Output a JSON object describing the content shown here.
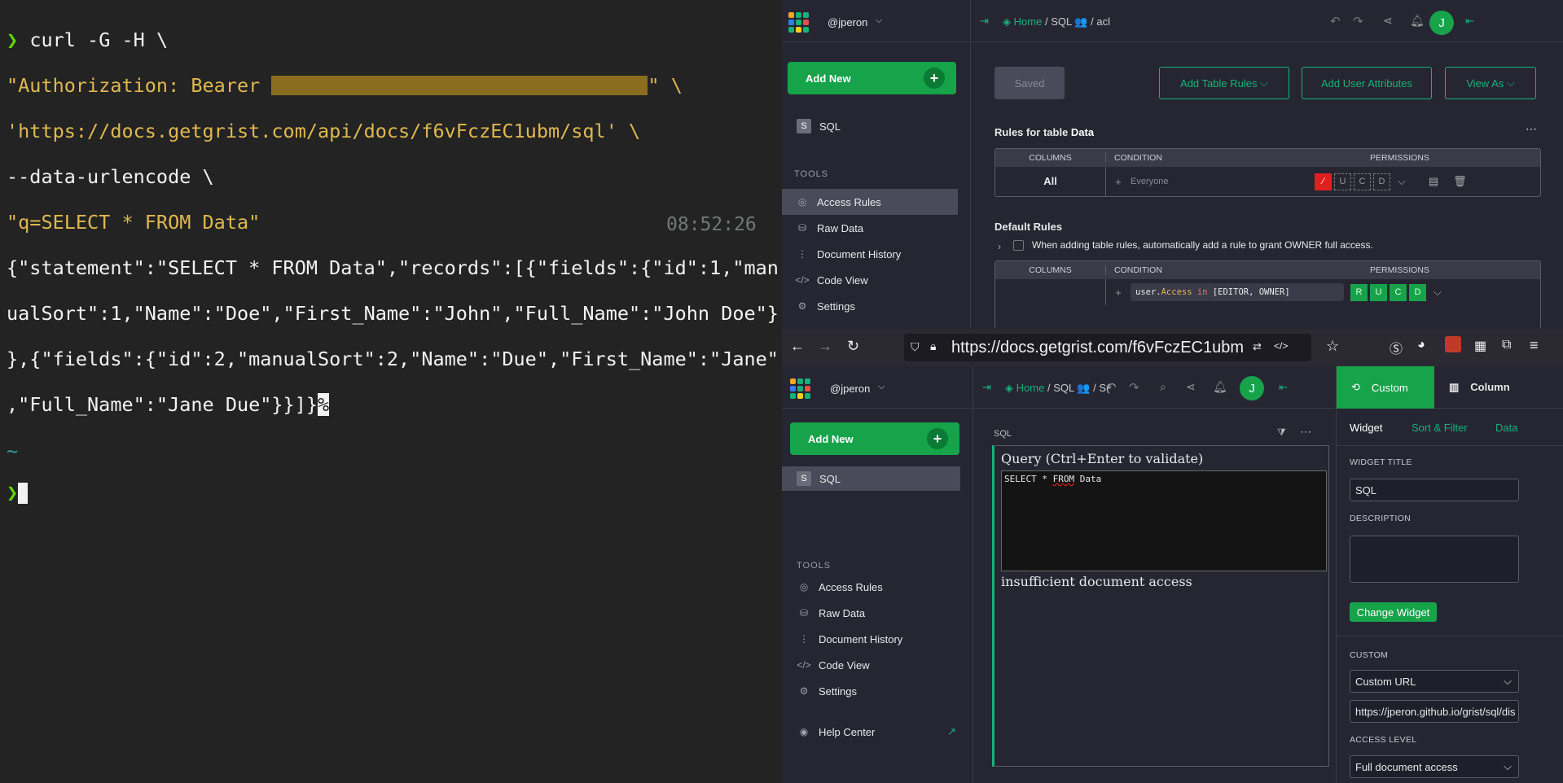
{
  "terminal": {
    "cmd1": "curl -G -H \\",
    "auth_prefix": "\"Authorization: Bearer ",
    "auth_suffix": "\" \\",
    "url_line": "'https://docs.getgrist.com/api/docs/f6vFczEC1ubm/sql' \\",
    "urlencode_line": "--data-urlencode \\",
    "query_line": "\"q=SELECT * FROM Data\"",
    "out1": "{\"statement\":\"SELECT * FROM Data\",\"records\":[{\"fields\":{\"id\":1,\"man",
    "out2": "ualSort\":1,\"Name\":\"Doe\",\"First_Name\":\"John\",\"Full_Name\":\"John Doe\"}",
    "out3": "},{\"fields\":{\"id\":2,\"manualSort\":2,\"Name\":\"Due\",\"First_Name\":\"Jane\"",
    "out4": ",\"Full_Name\":\"Jane Due\"}}]}",
    "percent": "%",
    "time": "08:52:26",
    "tilde": "~",
    "prompt_glyph": "❯"
  },
  "top_window": {
    "org": "@jperon",
    "breadcrumb": {
      "home": "Home",
      "doc": "SQL",
      "page": "acl"
    },
    "avatar": "J",
    "add_new": "Add New",
    "page_sql": "SQL",
    "tools_heading": "TOOLS",
    "tools": [
      "Access Rules",
      "Raw Data",
      "Document History",
      "Code View",
      "Settings"
    ],
    "saved_button": "Saved",
    "add_table_rules": "Add Table Rules",
    "add_user_attributes": "Add User Attributes",
    "view_as": "View As",
    "rules_for_table_prefix": "Rules for table ",
    "rules_for_table_name": "Data",
    "columns_header": "COLUMNS",
    "condition_header": "CONDITION",
    "permissions_header": "PERMISSIONS",
    "all_label": "All",
    "everyone_placeholder": "Everyone",
    "perm_letters": [
      "U",
      "C",
      "D"
    ],
    "default_rules": "Default Rules",
    "default_rules_checkbox": "When adding table rules, automatically add a rule to grant OWNER full access.",
    "condition_code_parts": [
      "user.",
      "Access",
      " in ",
      "[EDITOR, OWNER]"
    ],
    "perm_letters_full": [
      "R",
      "U",
      "C",
      "D"
    ]
  },
  "browser": {
    "url": "https://docs.getgrist.com/f6vFczEC1ubm"
  },
  "bottom_window": {
    "org": "@jperon",
    "breadcrumb": {
      "home": "Home",
      "doc": "SQL",
      "page": "S("
    },
    "avatar": "J",
    "add_new": "Add New",
    "page_sql": "SQL",
    "tools_heading": "TOOLS",
    "tools": [
      "Access Rules",
      "Raw Data",
      "Document History",
      "Code View",
      "Settings"
    ],
    "help_center": "Help Center",
    "widget_section_title": "SQL",
    "query_heading": "Query (Ctrl+Enter to validate)",
    "query_text_pre": "SELECT * ",
    "query_text_from": "FROM",
    "query_text_post": " Data",
    "error_text": "insufficient document access",
    "right_tabs": {
      "custom": "Custom",
      "column": "Column"
    },
    "sub_tabs": [
      "Widget",
      "Sort & Filter",
      "Data"
    ],
    "widget_title_label": "WIDGET TITLE",
    "widget_title_value": "SQL",
    "description_label": "DESCRIPTION",
    "change_widget": "Change Widget",
    "custom_label": "CUSTOM",
    "custom_select": "Custom URL",
    "custom_url": "https://jperon.github.io/grist/sql/dis",
    "access_level_label": "ACCESS LEVEL",
    "access_level_value": "Full document access"
  },
  "colors": {
    "accent": "#16b378",
    "terminal_green": "#5fd700",
    "terminal_string": "#e0b84f",
    "redaction": "#8b6d1f"
  }
}
